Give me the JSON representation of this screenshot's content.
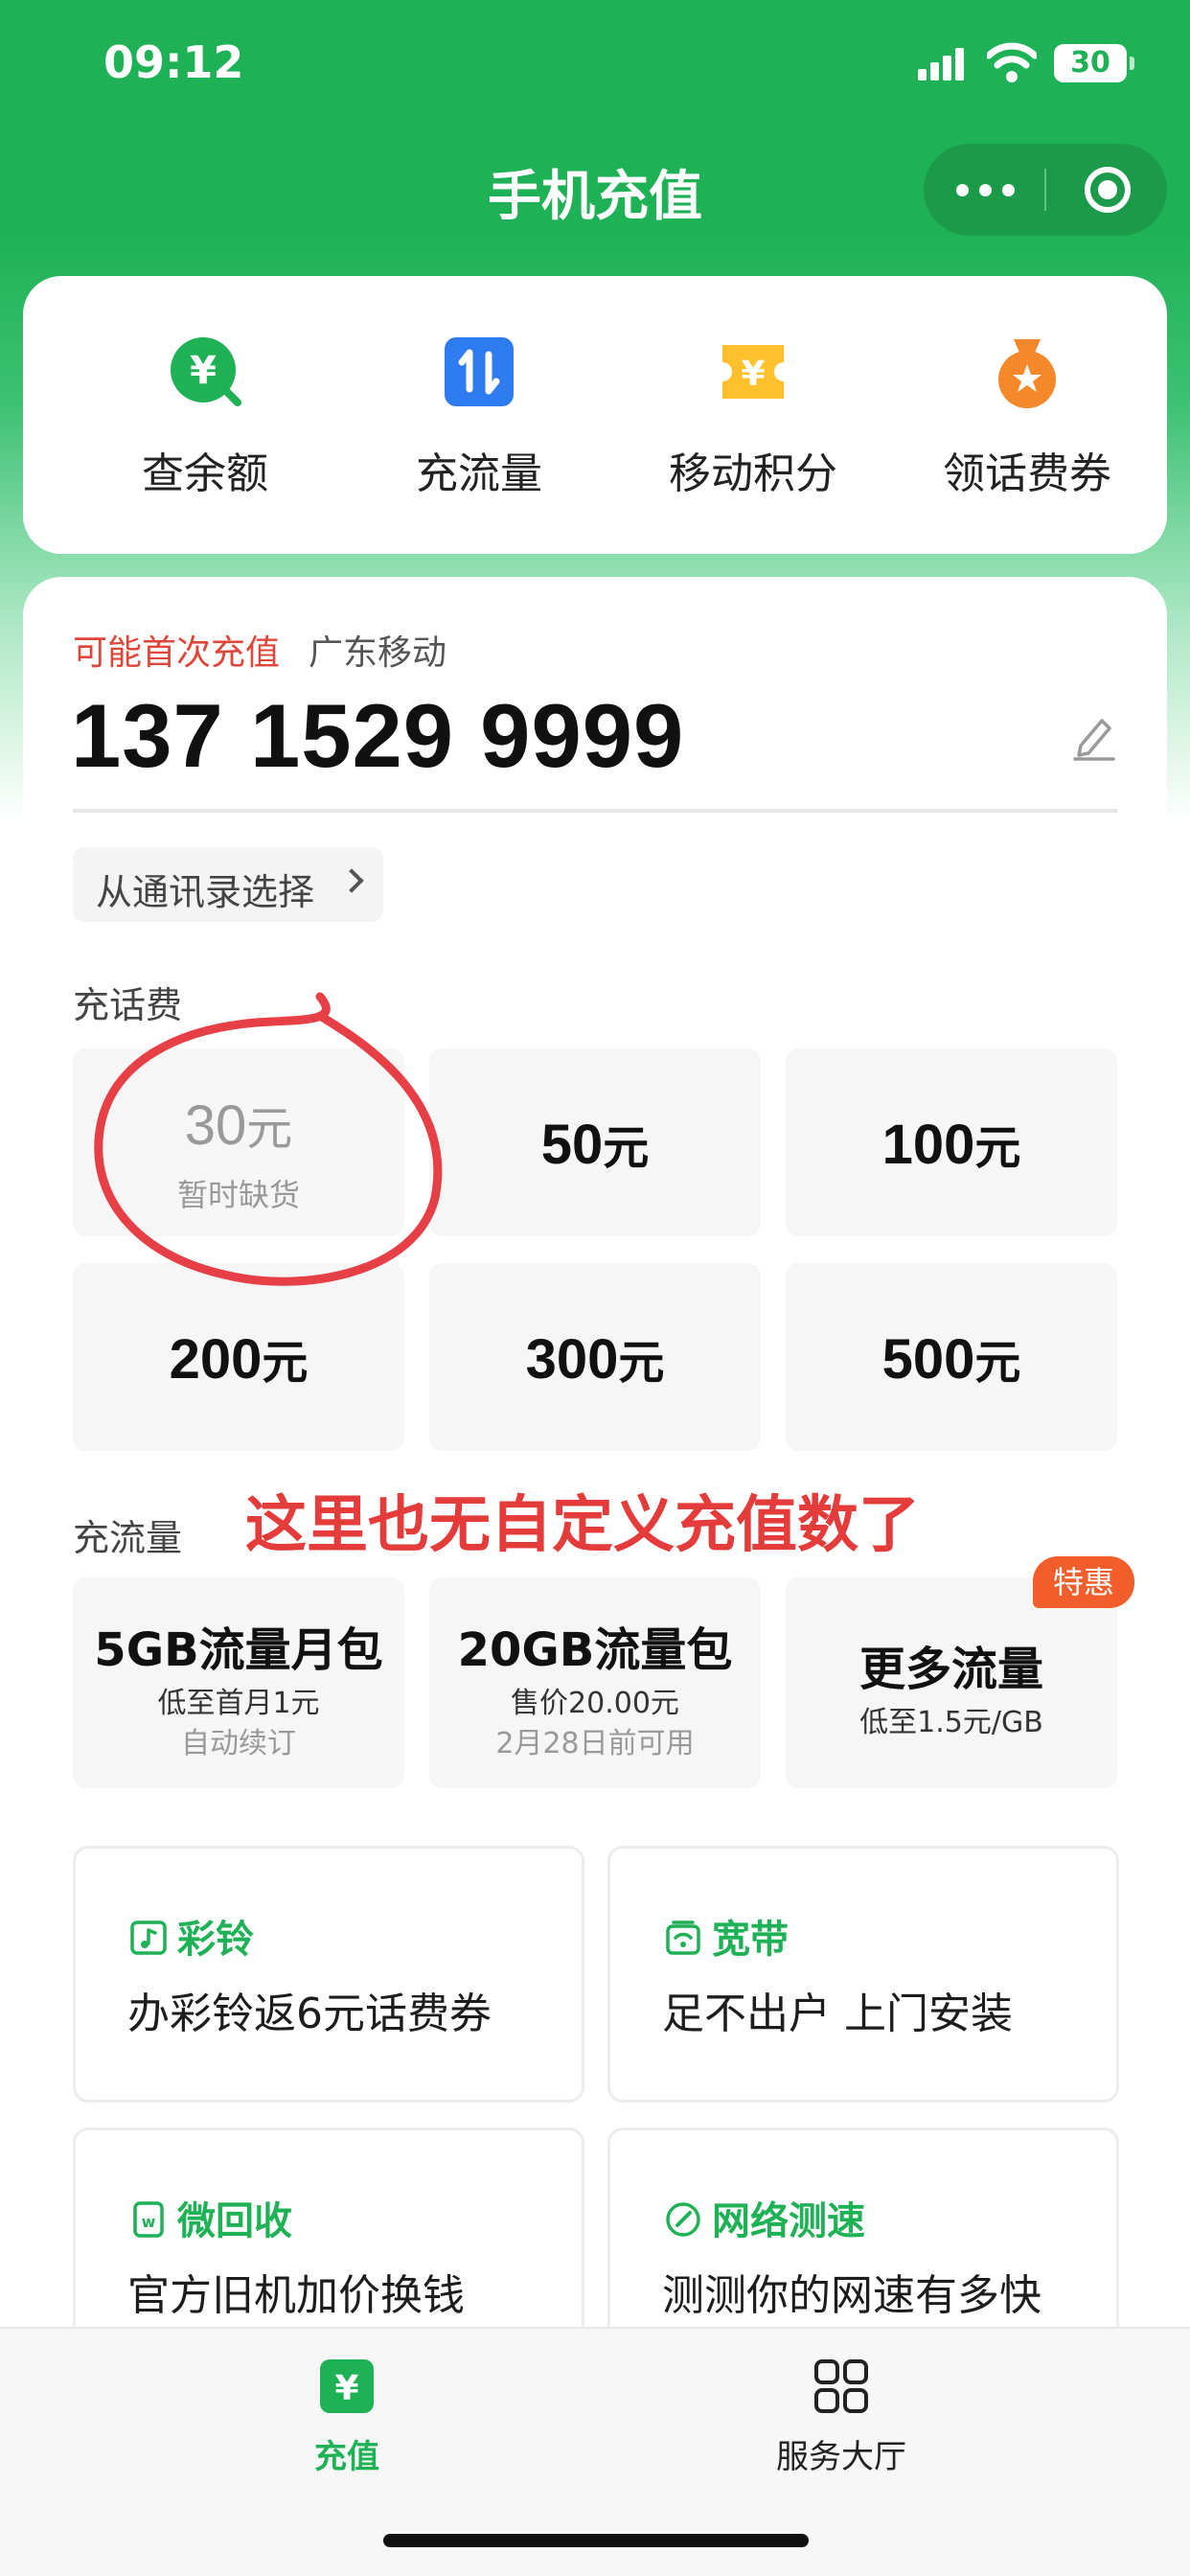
{
  "status": {
    "time": "09:12",
    "battery": "30"
  },
  "header": {
    "title": "手机充值"
  },
  "quick_actions": [
    {
      "label": "查余额",
      "icon": "balance-icon"
    },
    {
      "label": "充流量",
      "icon": "data-transfer-icon"
    },
    {
      "label": "移动积分",
      "icon": "points-ticket-icon"
    },
    {
      "label": "领话费券",
      "icon": "coupon-bag-icon"
    }
  ],
  "account": {
    "hint": "可能首次充值",
    "carrier": "广东移动",
    "phone": "137 1529 9999",
    "contacts_label": "从通讯录选择"
  },
  "topup": {
    "section_label": "充话费",
    "unit": "元",
    "amounts": [
      {
        "value": "30",
        "note": "暂时缺货",
        "available": false
      },
      {
        "value": "50",
        "available": true
      },
      {
        "value": "100",
        "available": true
      },
      {
        "value": "200",
        "available": true
      },
      {
        "value": "300",
        "available": true
      },
      {
        "value": "500",
        "available": true
      }
    ]
  },
  "annotation": "这里也无自定义充值数了",
  "data_plans": {
    "section_label": "充流量",
    "badge": "特惠",
    "items": [
      {
        "title": "5GB流量月包",
        "sub": "低至首月1元",
        "note": "自动续订"
      },
      {
        "title": "20GB流量包",
        "sub": "售价20.00元",
        "note": "2月28日前可用"
      },
      {
        "title": "更多流量",
        "sub": "低至1.5元/GB"
      }
    ]
  },
  "services": [
    {
      "title": "彩铃",
      "desc": "办彩铃返6元话费券",
      "icon": "ringtone-icon"
    },
    {
      "title": "宽带",
      "desc": "足不出户 上门安装",
      "icon": "broadband-router-icon"
    },
    {
      "title": "微回收",
      "desc": "官方旧机加价换钱",
      "icon": "recycle-phone-icon"
    },
    {
      "title": "网络测速",
      "desc": "测测你的网速有多快",
      "icon": "speed-gauge-icon"
    }
  ],
  "tabbar": [
    {
      "label": "充值",
      "icon": "yuan-icon",
      "active": true
    },
    {
      "label": "服务大厅",
      "icon": "grid-icon",
      "active": false
    }
  ],
  "colors": {
    "brand": "#1fb155",
    "alert": "#e0453a",
    "badge": "#f25d2c"
  }
}
